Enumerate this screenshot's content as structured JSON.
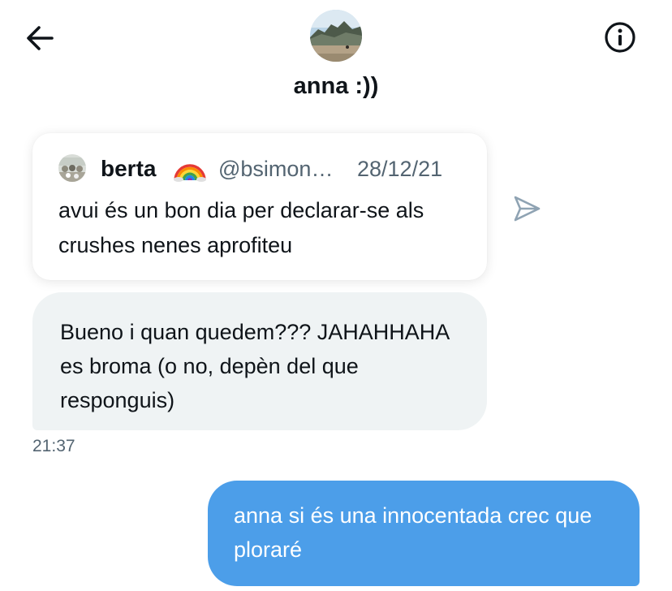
{
  "header": {
    "title": "anna :))",
    "back_icon": "back-arrow-icon",
    "info_icon": "info-icon"
  },
  "quoted_tweet": {
    "author_name": "berta",
    "author_emoji": "🌈",
    "handle": "@bsimon…",
    "date": "28/12/21",
    "text": "avui és un bon dia per declarar-se als crushes nenes aprofiteu"
  },
  "share_icon": "send-arrow-icon",
  "messages": [
    {
      "direction": "incoming",
      "text": "Bueno i quan quedem??? JAHAHHAHA es broma (o no, depèn del que responguis)",
      "time": "21:37"
    },
    {
      "direction": "outgoing",
      "text": "anna si és una innocentada crec que ploraré"
    }
  ],
  "colors": {
    "outgoing_bubble": "#4c9ee9",
    "incoming_bubble": "#eff3f4",
    "muted_text": "#536471",
    "primary_text": "#0f1419"
  }
}
